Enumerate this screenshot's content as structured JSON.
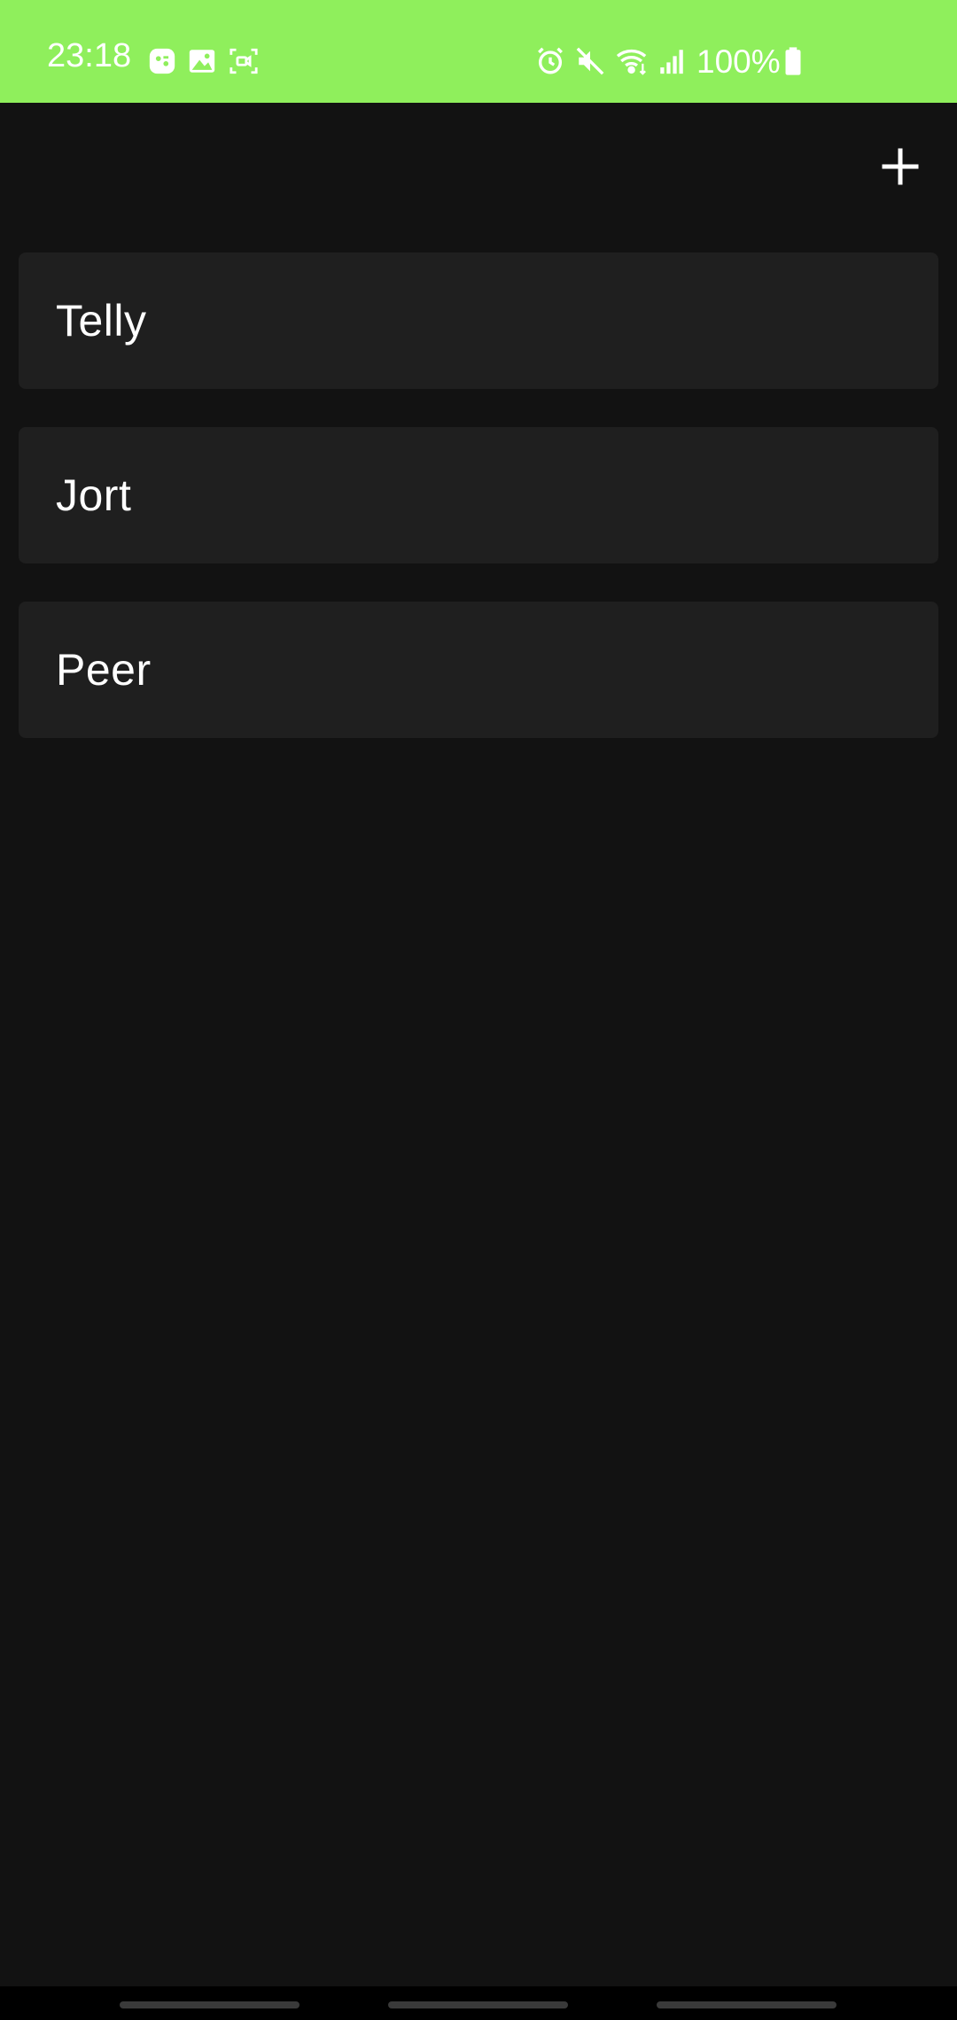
{
  "status_bar": {
    "time": "23:18",
    "battery_percent": "100%",
    "background_color": "#8fef5c",
    "left_icons": [
      "game-launcher-icon",
      "gallery-icon",
      "screen-recorder-icon"
    ],
    "right_icons": [
      "alarm-icon",
      "mute-icon",
      "wifi-icon",
      "signal-icon",
      "battery-icon"
    ]
  },
  "app_bar": {
    "add_icon": "plus-icon"
  },
  "list": {
    "items": [
      {
        "label": "Telly"
      },
      {
        "label": "Jort"
      },
      {
        "label": "Peer"
      }
    ]
  },
  "nav_bar": {
    "pills": 3
  }
}
